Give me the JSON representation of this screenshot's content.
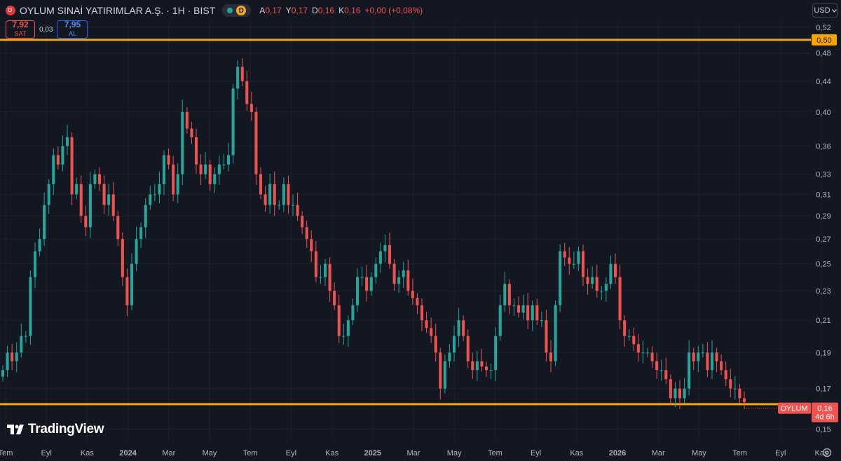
{
  "header": {
    "title": "OYLUM SINAİ YATIRIMLAR A.Ş. · 1H · BIST",
    "delay_badge": "D",
    "ohlc": [
      {
        "key": "A",
        "value": "0,17"
      },
      {
        "key": "Y",
        "value": "0,17"
      },
      {
        "key": "D",
        "value": "0,16"
      },
      {
        "key": "K",
        "value": "0,16"
      }
    ],
    "change": "+0,00 (+0,08%)"
  },
  "trade": {
    "sell_price": "7,92",
    "sell_label": "SAT",
    "spread": "0,03",
    "buy_price": "7,95",
    "buy_label": "AL"
  },
  "currency": "USD",
  "brand": "TradingView",
  "colors": {
    "background": "#131722",
    "up": "#26a69a",
    "down": "#ef5350",
    "level_line": "#f7a600",
    "axis_text": "#b2b5be"
  },
  "chart_data": {
    "type": "candlestick",
    "symbol_tag": "OYLUM",
    "last_price": "0,16",
    "countdown": "4d 6h",
    "y_axis": {
      "scale": "log",
      "range": [
        0.145,
        0.53
      ],
      "ticks": [
        "0,52",
        "0,48",
        "0,44",
        "0,40",
        "0,36",
        "0,33",
        "0,31",
        "0,29",
        "0,27",
        "0,25",
        "0,23",
        "0,21",
        "0,19",
        "0,17",
        "0,15"
      ]
    },
    "x_axis": {
      "ticks": [
        {
          "label": "Tem",
          "bold": false
        },
        {
          "label": "Eyl",
          "bold": false
        },
        {
          "label": "Kas",
          "bold": false
        },
        {
          "label": "2024",
          "bold": true
        },
        {
          "label": "Mar",
          "bold": false
        },
        {
          "label": "May",
          "bold": false
        },
        {
          "label": "Tem",
          "bold": false
        },
        {
          "label": "Eyl",
          "bold": false
        },
        {
          "label": "Kas",
          "bold": false
        },
        {
          "label": "2025",
          "bold": true
        },
        {
          "label": "Mar",
          "bold": false
        },
        {
          "label": "May",
          "bold": false
        },
        {
          "label": "Tem",
          "bold": false
        },
        {
          "label": "Eyl",
          "bold": false
        },
        {
          "label": "Kas",
          "bold": false
        },
        {
          "label": "2026",
          "bold": true
        },
        {
          "label": "Mar",
          "bold": false
        },
        {
          "label": "May",
          "bold": false
        },
        {
          "label": "Tem",
          "bold": false
        },
        {
          "label": "Eyl",
          "bold": false
        },
        {
          "label": "Kas",
          "bold": false
        }
      ]
    },
    "levels": [
      {
        "value": 0.5,
        "label": "0,50"
      },
      {
        "value": 0.162,
        "label": "0,16"
      }
    ],
    "closes": [
      0.18,
      0.19,
      0.185,
      0.19,
      0.2,
      0.2,
      0.24,
      0.26,
      0.27,
      0.3,
      0.32,
      0.35,
      0.34,
      0.36,
      0.37,
      0.31,
      0.32,
      0.29,
      0.28,
      0.32,
      0.33,
      0.32,
      0.3,
      0.31,
      0.29,
      0.27,
      0.24,
      0.22,
      0.25,
      0.27,
      0.28,
      0.3,
      0.31,
      0.31,
      0.32,
      0.35,
      0.34,
      0.31,
      0.33,
      0.4,
      0.38,
      0.37,
      0.34,
      0.33,
      0.34,
      0.32,
      0.33,
      0.34,
      0.34,
      0.35,
      0.43,
      0.46,
      0.44,
      0.41,
      0.4,
      0.33,
      0.31,
      0.3,
      0.32,
      0.3,
      0.3,
      0.32,
      0.3,
      0.3,
      0.29,
      0.28,
      0.27,
      0.26,
      0.24,
      0.24,
      0.25,
      0.23,
      0.22,
      0.2,
      0.2,
      0.21,
      0.22,
      0.24,
      0.24,
      0.23,
      0.24,
      0.25,
      0.26,
      0.265,
      0.25,
      0.235,
      0.24,
      0.245,
      0.23,
      0.225,
      0.22,
      0.21,
      0.205,
      0.2,
      0.19,
      0.17,
      0.185,
      0.19,
      0.2,
      0.21,
      0.2,
      0.185,
      0.18,
      0.185,
      0.182,
      0.18,
      0.18,
      0.2,
      0.22,
      0.235,
      0.22,
      0.22,
      0.215,
      0.22,
      0.21,
      0.22,
      0.21,
      0.21,
      0.19,
      0.185,
      0.22,
      0.26,
      0.255,
      0.25,
      0.25,
      0.26,
      0.24,
      0.235,
      0.24,
      0.23,
      0.23,
      0.235,
      0.25,
      0.24,
      0.21,
      0.2,
      0.2,
      0.195,
      0.19,
      0.19,
      0.19,
      0.185,
      0.18,
      0.18,
      0.175,
      0.165,
      0.17,
      0.165,
      0.17,
      0.19,
      0.185,
      0.19,
      0.19,
      0.18,
      0.19,
      0.185,
      0.18,
      0.175,
      0.17,
      0.17,
      0.165,
      0.163
    ]
  }
}
